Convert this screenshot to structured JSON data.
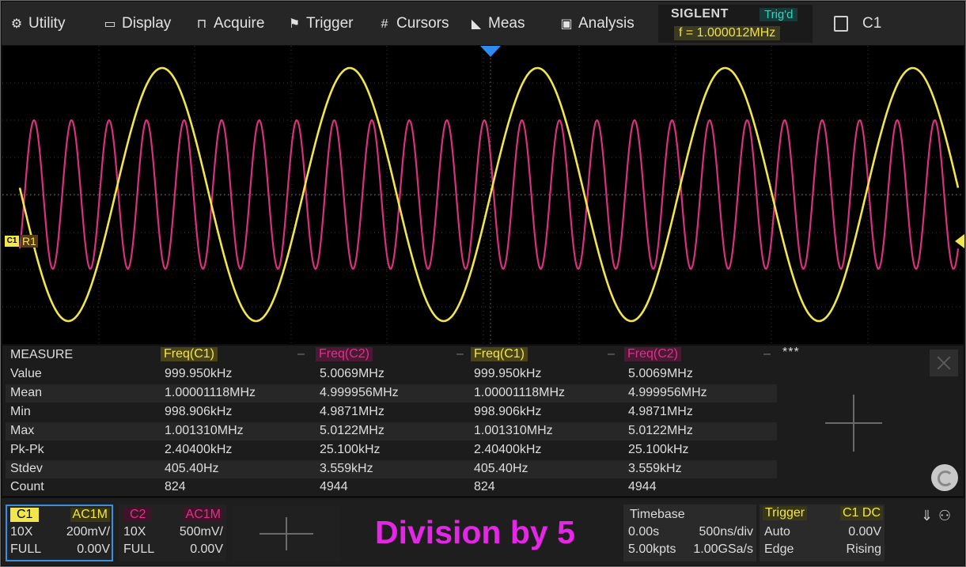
{
  "menu": [
    {
      "icon": "gear-icon",
      "glyph": "⚙",
      "label": "Utility"
    },
    {
      "icon": "display-icon",
      "glyph": "▭",
      "label": "Display"
    },
    {
      "icon": "acquire-icon",
      "glyph": "⊓",
      "label": "Acquire"
    },
    {
      "icon": "flag-icon",
      "glyph": "⚑",
      "label": "Trigger"
    },
    {
      "icon": "hash-icon",
      "glyph": "#",
      "label": "Cursors"
    },
    {
      "icon": "meas-icon",
      "glyph": "◣",
      "label": "Meas"
    },
    {
      "icon": "analysis-icon",
      "glyph": "▣",
      "label": "Analysis"
    }
  ],
  "brand": "SIGLENT",
  "trigger_state": "Trig'd",
  "trigger_frequency": "f = 1.000012MHz",
  "active_channel": "C1",
  "waveform": {
    "channel1_marker": "C1",
    "ref_label": "R1",
    "colors": {
      "c1": "#f2e64a",
      "c2": "#d9307f",
      "grid": "#3a3a3a"
    },
    "c1_cycles": 5,
    "c2_cycles": 25
  },
  "measure": {
    "title": "MEASURE",
    "more": "***",
    "headers": [
      "Freq(C1)",
      "Freq(C2)",
      "Freq(C1)",
      "Freq(C2)"
    ],
    "rows": [
      {
        "label": "Value",
        "values": [
          "999.950kHz",
          "5.0069MHz",
          "999.950kHz",
          "5.0069MHz"
        ]
      },
      {
        "label": "Mean",
        "values": [
          "1.00001118MHz",
          "4.999956MHz",
          "1.00001118MHz",
          "4.999956MHz"
        ]
      },
      {
        "label": "Min",
        "values": [
          "998.906kHz",
          "4.9871MHz",
          "998.906kHz",
          "4.9871MHz"
        ]
      },
      {
        "label": "Max",
        "values": [
          "1.001310MHz",
          "5.0122MHz",
          "1.001310MHz",
          "5.0122MHz"
        ]
      },
      {
        "label": "Pk-Pk",
        "values": [
          "2.40400kHz",
          "25.100kHz",
          "2.40400kHz",
          "25.100kHz"
        ]
      },
      {
        "label": "Stdev",
        "values": [
          "405.40Hz",
          "3.559kHz",
          "405.40Hz",
          "3.559kHz"
        ]
      },
      {
        "label": "Count",
        "values": [
          "824",
          "4944",
          "824",
          "4944"
        ]
      }
    ]
  },
  "channels": [
    {
      "name": "C1",
      "coupling": "AC1M",
      "probe": "10X",
      "scale": "200mV/",
      "bandwidth": "FULL",
      "offset": "0.00V"
    },
    {
      "name": "C2",
      "coupling": "AC1M",
      "probe": "10X",
      "scale": "500mV/",
      "bandwidth": "FULL",
      "offset": "0.00V"
    }
  ],
  "caption": "Division by 5",
  "timebase": {
    "title": "Timebase",
    "delay": "0.00s",
    "scale": "500ns/div",
    "memory": "5.00kpts",
    "sample_rate": "1.00GSa/s"
  },
  "trigger": {
    "title": "Trigger",
    "source": "C1 DC",
    "mode": "Auto",
    "level": "0.00V",
    "type": "Edge",
    "slope": "Rising"
  }
}
